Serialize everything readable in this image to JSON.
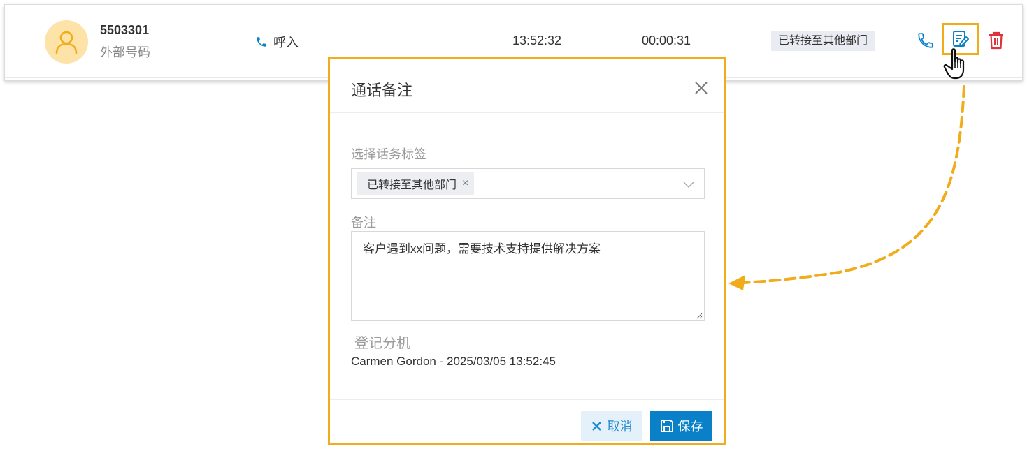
{
  "call_row": {
    "number": "5503301",
    "caller_type": "外部号码",
    "direction": "呼入",
    "time": "13:52:32",
    "duration": "00:00:31",
    "tag": "已转接至其他部门"
  },
  "dialog": {
    "title": "通话备注",
    "tags_label": "选择话务标签",
    "selected_tag": "已转接至其他部门",
    "note_label": "备注",
    "note_value": "客户遇到xx问题，需要技术支持提供解决方案",
    "extension_label": "登记分机",
    "extension_value": "Carmen Gordon - 2025/03/05 13:52:45",
    "cancel_label": "取消",
    "save_label": "保存"
  },
  "icons": {
    "avatar": "user-icon",
    "direction": "phone-icon",
    "call_action": "phone-icon",
    "note_action": "edit-note-icon",
    "delete_action": "trash-icon",
    "close": "close-icon",
    "dropdown": "chevron-down-icon",
    "cancel": "x-icon",
    "save": "save-icon",
    "cursor": "hand-pointer-icon"
  },
  "colors": {
    "accent": "#0a80c8",
    "highlight": "#f1ac1b",
    "danger": "#e0303a",
    "avatar_bg": "#fde3a7"
  }
}
